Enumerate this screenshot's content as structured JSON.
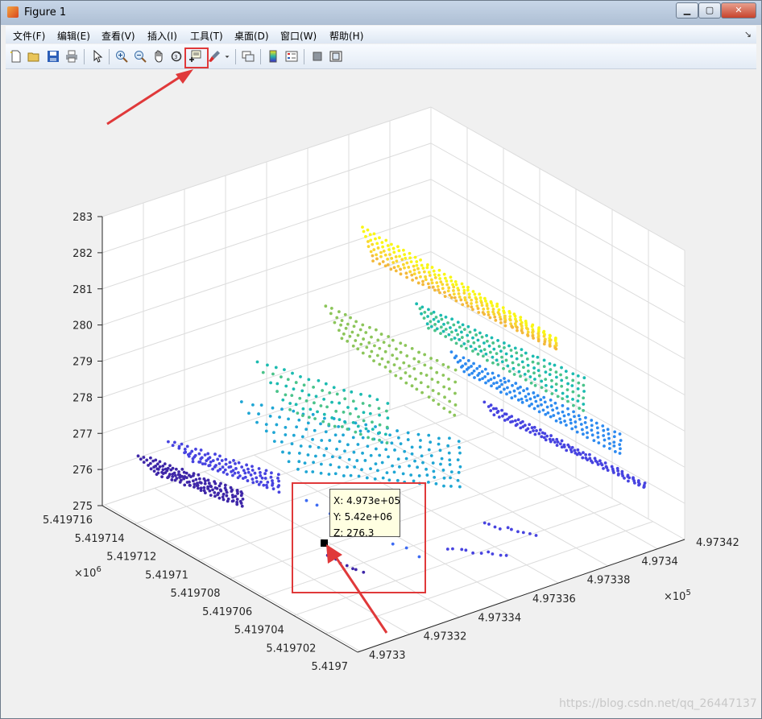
{
  "window": {
    "title": "Figure 1",
    "buttons": {
      "minimize": "▁",
      "maximize": "▢",
      "close": "✕"
    }
  },
  "menu": [
    "文件(F)",
    "编辑(E)",
    "查看(V)",
    "插入(I)",
    "工具(T)",
    "桌面(D)",
    "窗口(W)",
    "帮助(H)"
  ],
  "toolbar": {
    "icons": [
      "new-figure-icon",
      "open-file-icon",
      "save-icon",
      "print-icon",
      "pointer-icon",
      "zoom-in-icon",
      "zoom-out-icon",
      "pan-icon",
      "rotate-3d-icon",
      "data-cursor-icon",
      "brush-icon",
      "brush-dropdown-icon",
      "link-plot-icon",
      "colorbar-icon",
      "legend-icon",
      "hide-plot-tools-icon",
      "show-plot-tools-icon"
    ],
    "highlight_color": "#e0393a"
  },
  "axes": {
    "z_ticks": [
      "275",
      "276",
      "277",
      "278",
      "279",
      "280",
      "281",
      "282",
      "283"
    ],
    "y_ticks": [
      "5.419716",
      "5.419714",
      "5.419712",
      "5.41971",
      "5.419708",
      "5.419706",
      "5.419704",
      "5.419702",
      "5.4197"
    ],
    "x_ticks": [
      "4.9733",
      "4.97332",
      "4.97334",
      "4.97336",
      "4.97338",
      "4.9734",
      "4.97342"
    ],
    "y_exponent": "×10",
    "y_exponent_power": "6",
    "x_exponent": "×10",
    "x_exponent_power": "5"
  },
  "datatip": {
    "x": "X: 4.973e+05",
    "y": "Y: 5.42e+06",
    "z": "Z: 276.3"
  },
  "chart_data": {
    "type": "scatter",
    "xlim": [
      497330,
      497342
    ],
    "ylim": [
      5419700,
      5419716
    ],
    "zlim": [
      275,
      283
    ],
    "colormap": "parula"
  },
  "watermark": "https://blog.csdn.net/qq_26447137",
  "colors": {
    "accent_red": "#e0393a",
    "tip_bg": "#ffffe1"
  }
}
